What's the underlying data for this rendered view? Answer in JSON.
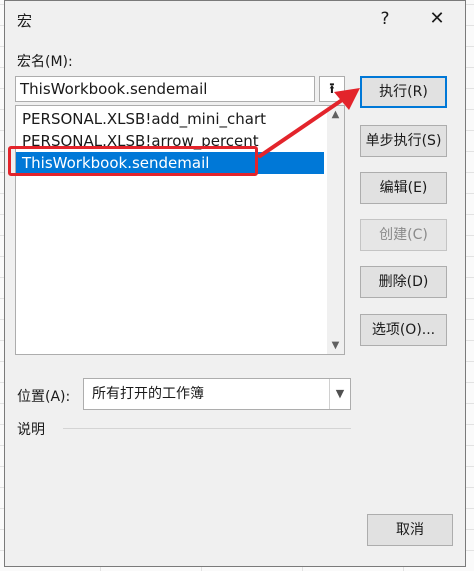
{
  "dialog": {
    "title": "宏",
    "help_glyph": "?",
    "close_glyph": "✕"
  },
  "macro_name": {
    "label": "宏名(M):",
    "value": "ThisWorkbook.sendemail"
  },
  "macro_list": {
    "items": [
      {
        "label": "PERSONAL.XLSB!add_mini_chart",
        "selected": false
      },
      {
        "label": "PERSONAL.XLSB!arrow_percent",
        "selected": false
      },
      {
        "label": "ThisWorkbook.sendemail",
        "selected": true
      }
    ]
  },
  "buttons": {
    "run": "执行(R)",
    "step_into": "单步执行(S)",
    "edit": "编辑(E)",
    "create": "创建(C)",
    "delete": "删除(D)",
    "options": "选项(O)...",
    "cancel": "取消"
  },
  "location": {
    "label": "位置(A):",
    "value": "所有打开的工作簿"
  },
  "description": {
    "label": "说明"
  },
  "icons": {
    "upload": "upload-arrow-icon",
    "scroll_up": "chevron-up-icon",
    "scroll_down": "chevron-down-icon",
    "dropdown": "chevron-down-icon"
  },
  "colors": {
    "selection": "#0078d7",
    "annotation": "#e3242b"
  }
}
